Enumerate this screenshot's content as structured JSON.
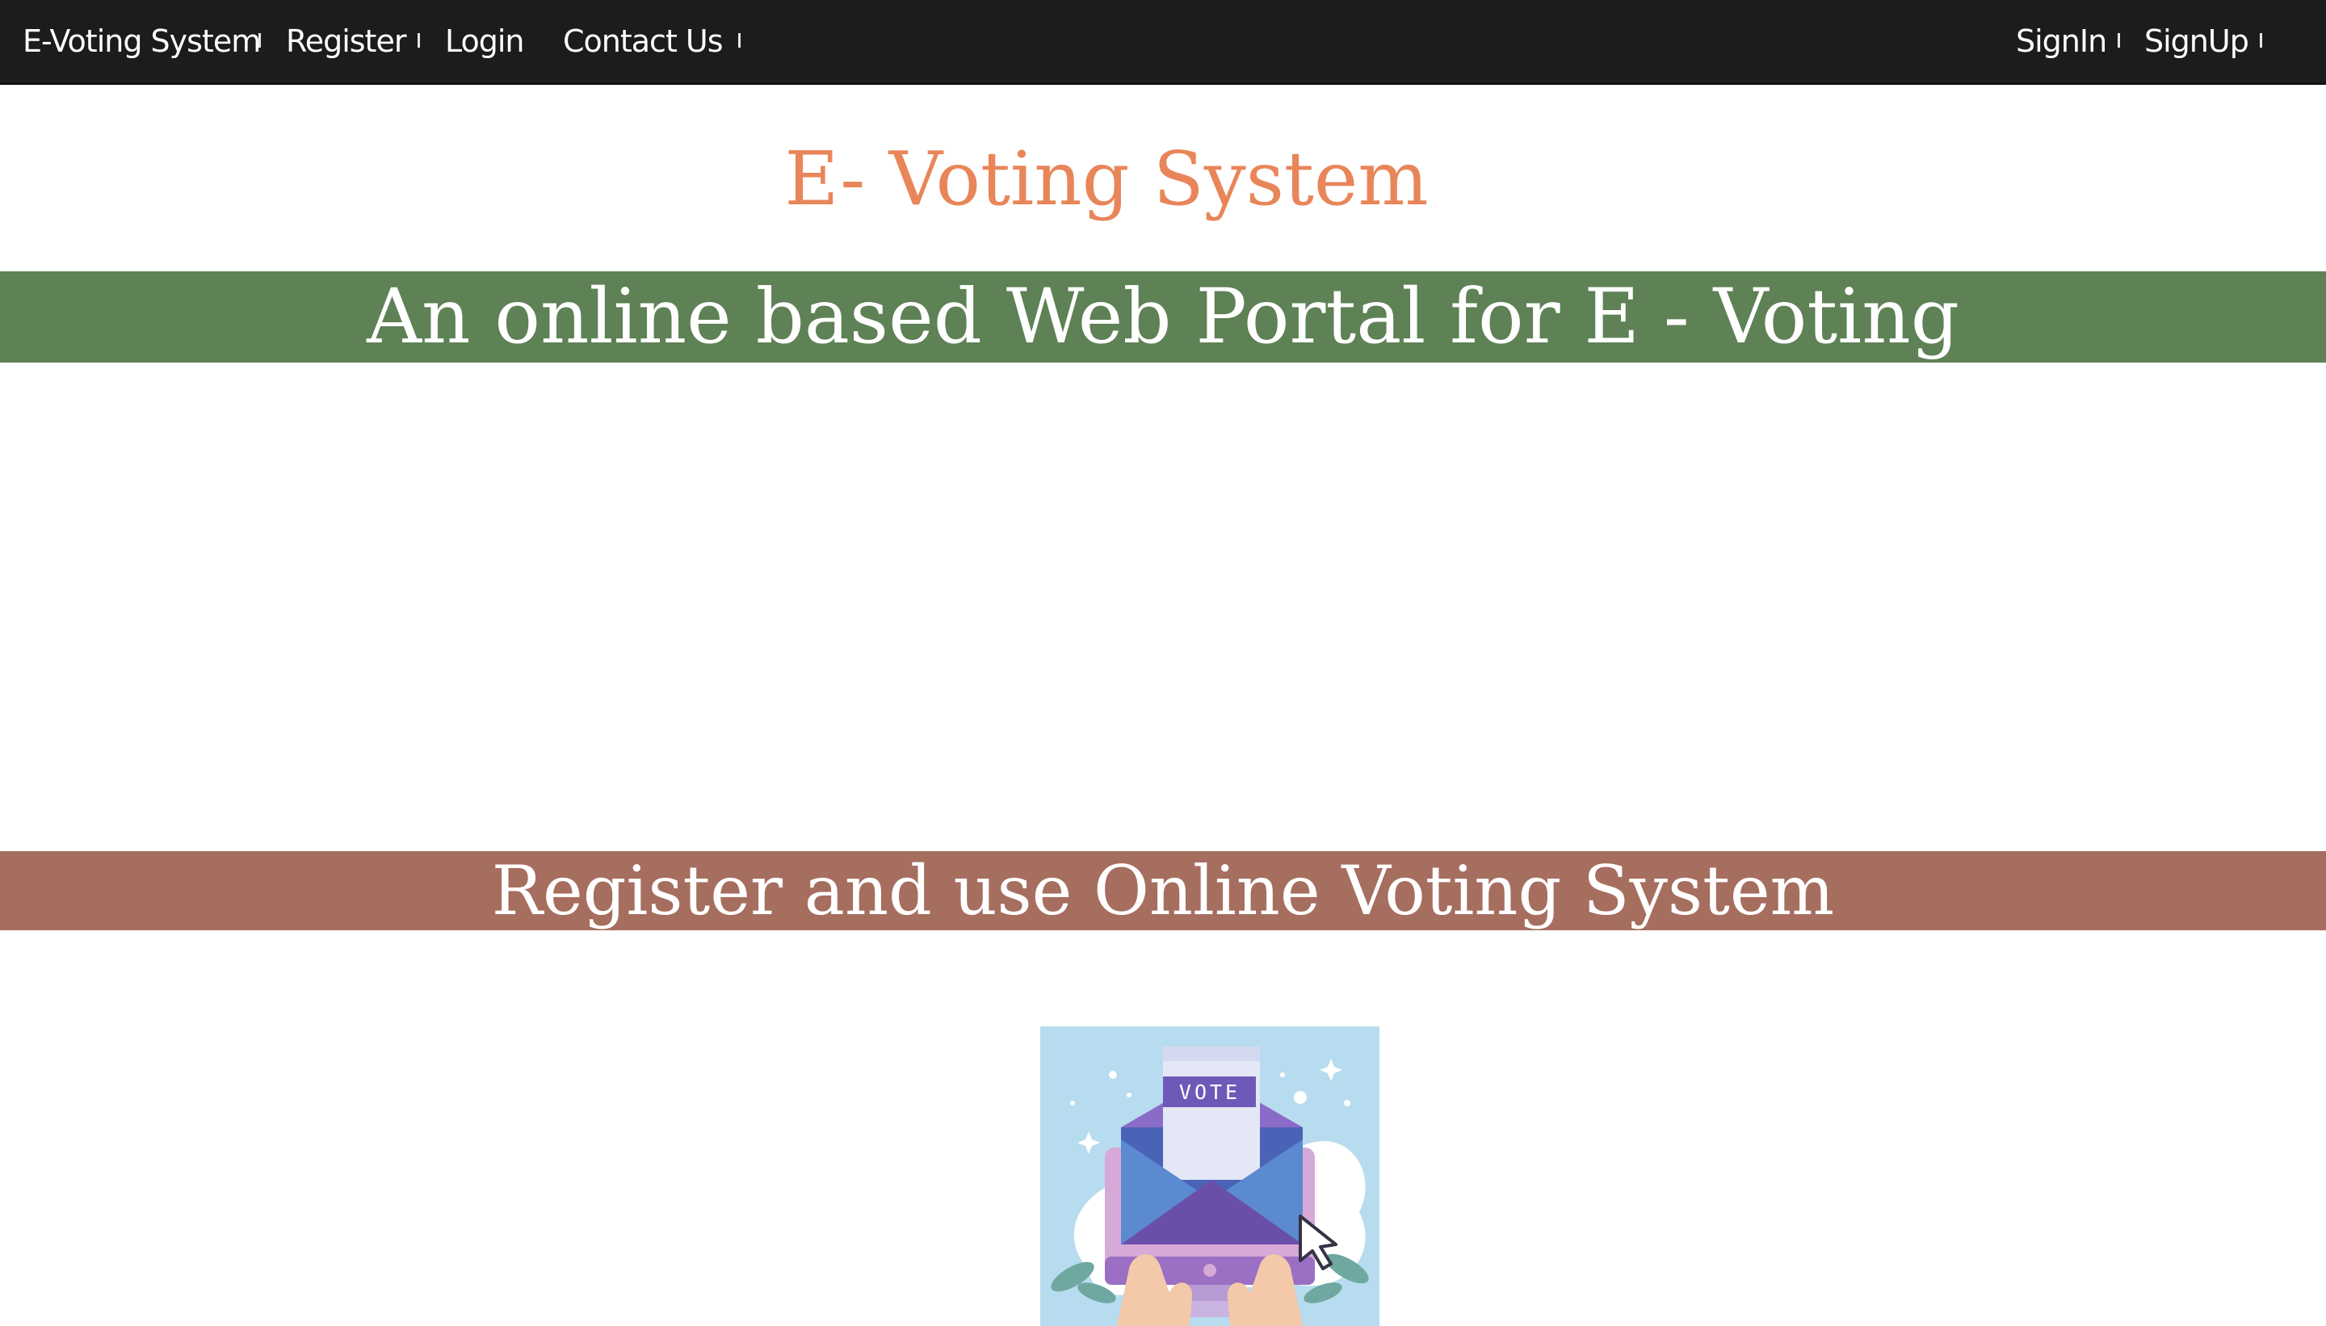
{
  "navbar": {
    "brand": "E-Voting System",
    "left_items": [
      {
        "label": "Register"
      },
      {
        "label": "Login"
      },
      {
        "label": "Contact Us"
      }
    ],
    "right_items": [
      {
        "label": "SignIn"
      },
      {
        "label": "SignUp"
      }
    ]
  },
  "page": {
    "title": "E- Voting System",
    "tagline": "An online based Web Portal for E - Voting",
    "cta_banner": "Register and use Online Voting System"
  },
  "illustration": {
    "ballot_label": "VOTE",
    "icons": [
      "ballot-paper-icon",
      "envelope-icon",
      "monitor-icon",
      "hands-icon",
      "cursor-arrow-icon",
      "leaves-icon",
      "sparkle-icon"
    ]
  },
  "colors": {
    "navbar_bg": "#1c1c1c",
    "title": "#e8865a",
    "green_band": "#5e8155",
    "red_band": "#a66e5f",
    "illustration_bg": "#b8dcef"
  }
}
